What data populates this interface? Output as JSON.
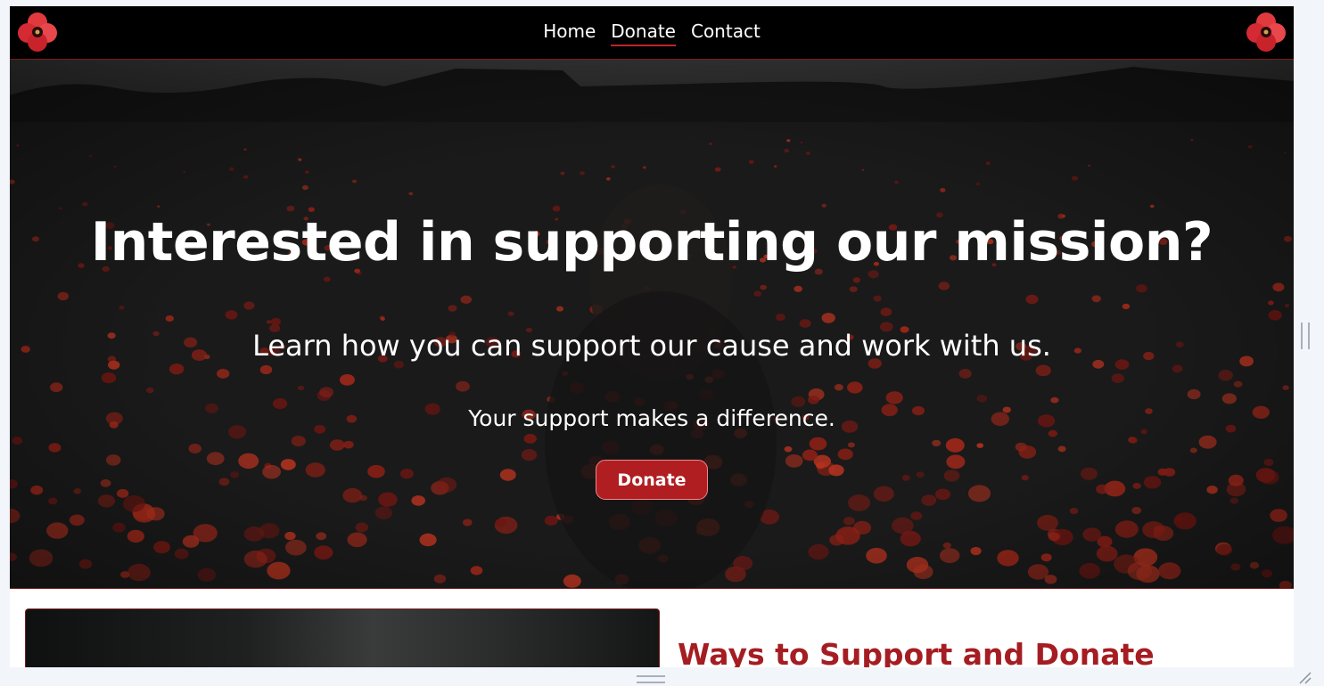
{
  "nav": {
    "links": [
      {
        "label": "Home",
        "active": false
      },
      {
        "label": "Donate",
        "active": true
      },
      {
        "label": "Contact",
        "active": false
      }
    ],
    "logo_icon": "poppy-icon"
  },
  "hero": {
    "title": "Interested in supporting our mission?",
    "subtitle": "Learn how you can support our cause and work with us.",
    "note": "Your support makes a difference.",
    "button_label": "Donate",
    "background": "dark poppy field"
  },
  "section": {
    "title": "Ways to Support and Donate"
  },
  "colors": {
    "accent": "#b01e22",
    "nav_bg": "#000000",
    "heading_red": "#a51d22",
    "page_bg": "#f2f5fa"
  }
}
